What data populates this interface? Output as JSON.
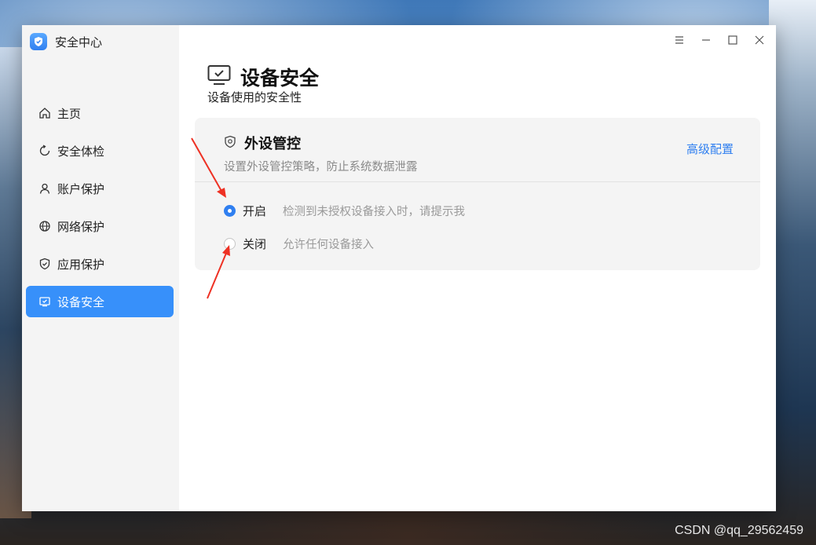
{
  "app": {
    "title": "安全中心",
    "icon": "shield-icon"
  },
  "titlebar": {
    "menu_icon": "menu-icon",
    "min_icon": "minimize-icon",
    "max_icon": "maximize-icon",
    "close_icon": "close-icon"
  },
  "sidebar": {
    "items": [
      {
        "label": "主页",
        "icon": "home-icon",
        "active": false
      },
      {
        "label": "安全体检",
        "icon": "refresh-icon",
        "active": false
      },
      {
        "label": "账户保护",
        "icon": "user-icon",
        "active": false
      },
      {
        "label": "网络保护",
        "icon": "globe-icon",
        "active": false
      },
      {
        "label": "应用保护",
        "icon": "shield-check-icon",
        "active": false
      },
      {
        "label": "设备安全",
        "icon": "monitor-check-icon",
        "active": true
      }
    ]
  },
  "page": {
    "title": "设备安全",
    "subtitle": "设备使用的安全性",
    "title_icon": "monitor-check-icon"
  },
  "card": {
    "title": "外设管控",
    "icon": "shield-icon",
    "desc": "设置外设管控策略，防止系统数据泄露",
    "link": "高级配置",
    "options": [
      {
        "label": "开启",
        "desc": "检测到未授权设备接入时，请提示我",
        "checked": true
      },
      {
        "label": "关闭",
        "desc": "允许任何设备接入",
        "checked": false
      }
    ]
  },
  "colors": {
    "accent": "#3790fa",
    "link": "#2f7ff0",
    "arrow": "#ee3124"
  },
  "watermark": "CSDN @qq_29562459"
}
